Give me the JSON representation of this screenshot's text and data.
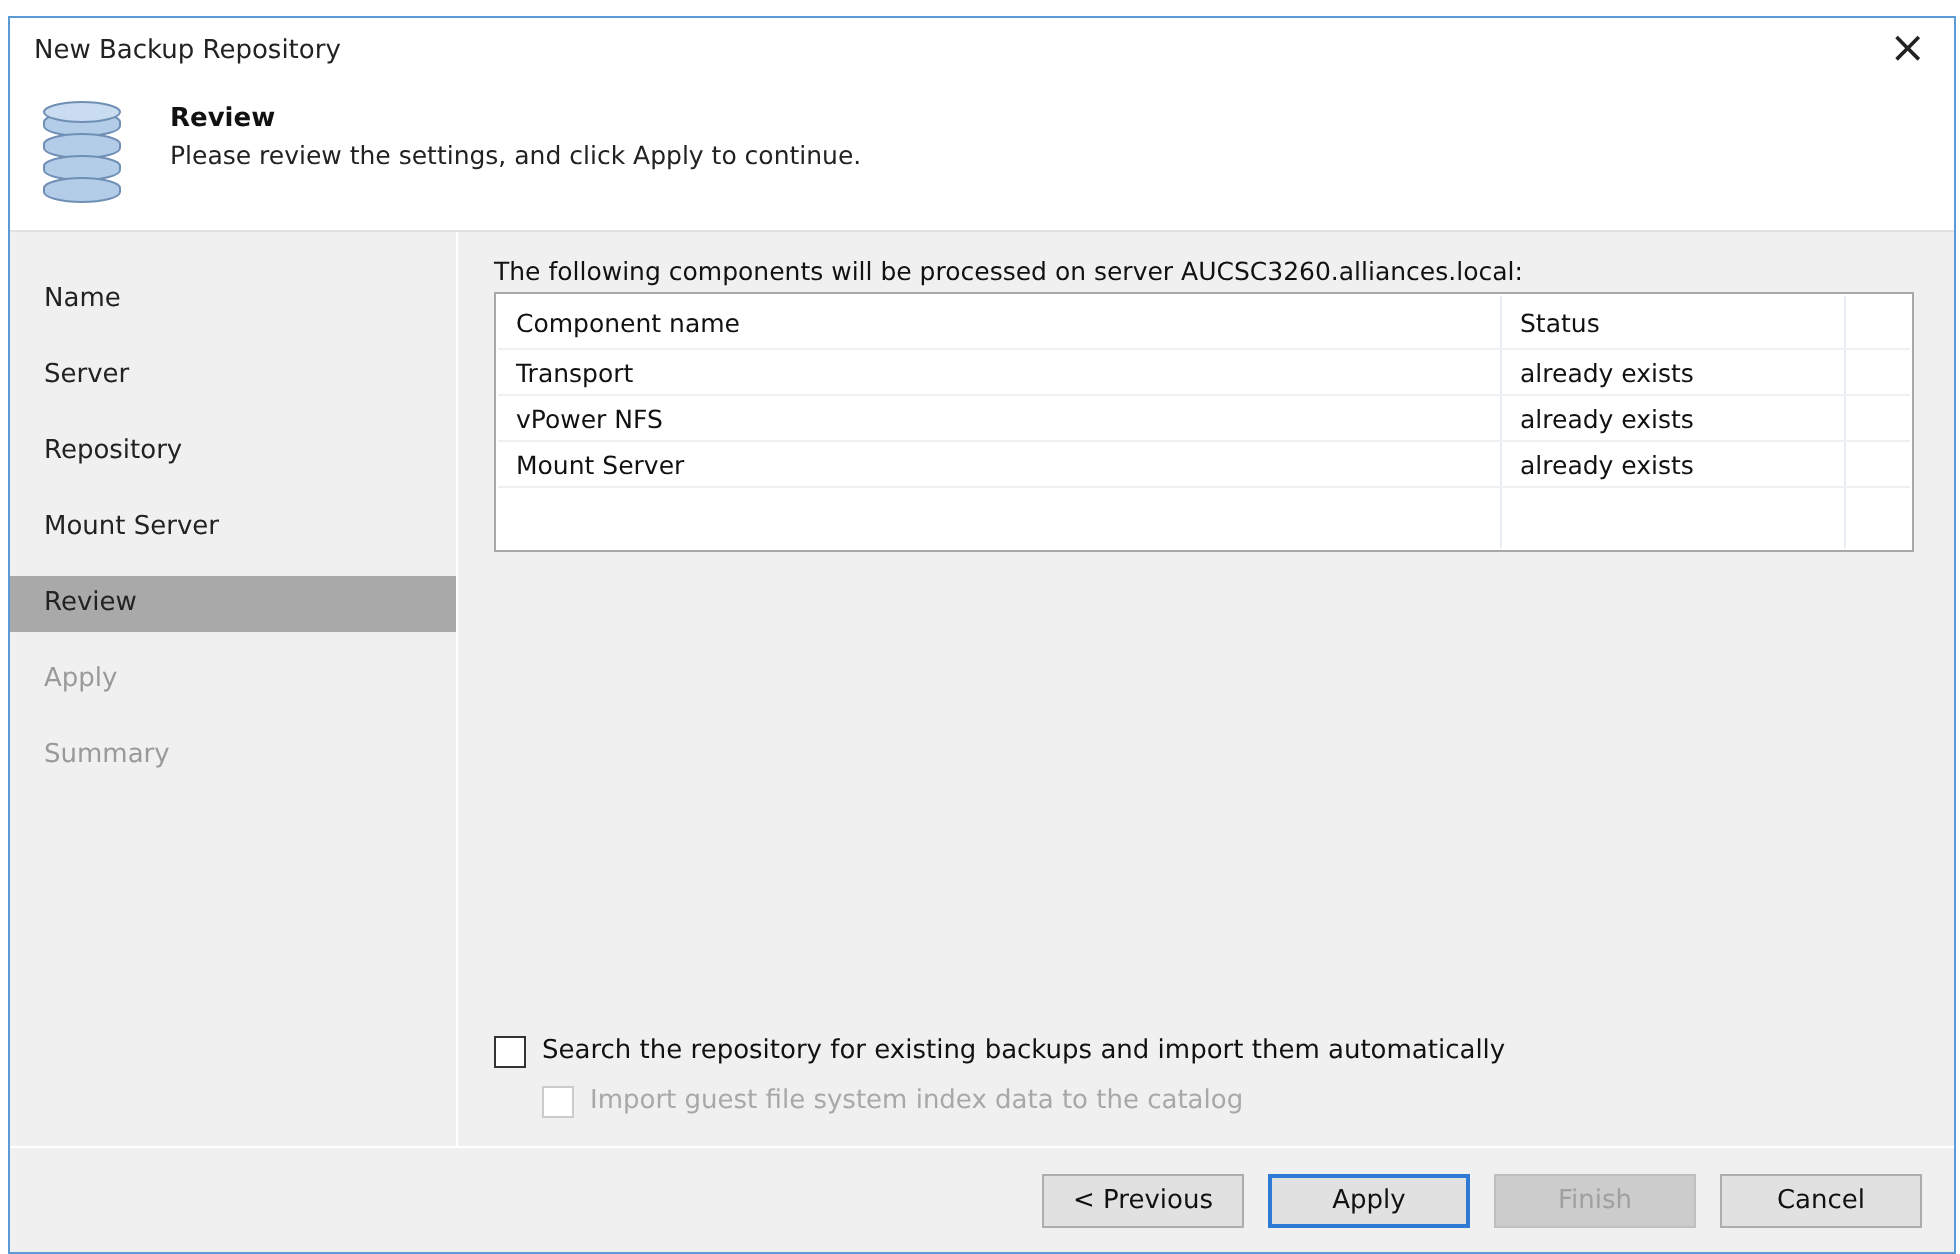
{
  "window": {
    "title": "New Backup Repository",
    "close_icon": "×"
  },
  "header": {
    "title": "Review",
    "subtitle": "Please review the settings, and click Apply to continue."
  },
  "steps": [
    {
      "label": "Name",
      "selected": false,
      "disabled": false
    },
    {
      "label": "Server",
      "selected": false,
      "disabled": false
    },
    {
      "label": "Repository",
      "selected": false,
      "disabled": false
    },
    {
      "label": "Mount Server",
      "selected": false,
      "disabled": false
    },
    {
      "label": "Review",
      "selected": true,
      "disabled": false
    },
    {
      "label": "Apply",
      "selected": false,
      "disabled": true
    },
    {
      "label": "Summary",
      "selected": false,
      "disabled": true
    }
  ],
  "intro": "The following components will be processed on server AUCSC3260.alliances.local:",
  "table": {
    "columns": [
      "Component name",
      "Status"
    ],
    "rows": [
      [
        "Transport",
        "already exists"
      ],
      [
        "vPower NFS",
        "already exists"
      ],
      [
        "Mount Server",
        "already exists"
      ]
    ]
  },
  "options": [
    {
      "label": "Search the repository for existing backups and import them automatically",
      "checked": false,
      "disabled": false,
      "indent": false
    },
    {
      "label": "Import guest file system index data to the catalog",
      "checked": false,
      "disabled": true,
      "indent": true
    }
  ],
  "buttons": [
    {
      "label": "< Previous",
      "disabled": false,
      "default": false
    },
    {
      "label": "Apply",
      "disabled": false,
      "default": true
    },
    {
      "label": "Finish",
      "disabled": true,
      "default": false
    },
    {
      "label": "Cancel",
      "disabled": false,
      "default": false
    }
  ]
}
